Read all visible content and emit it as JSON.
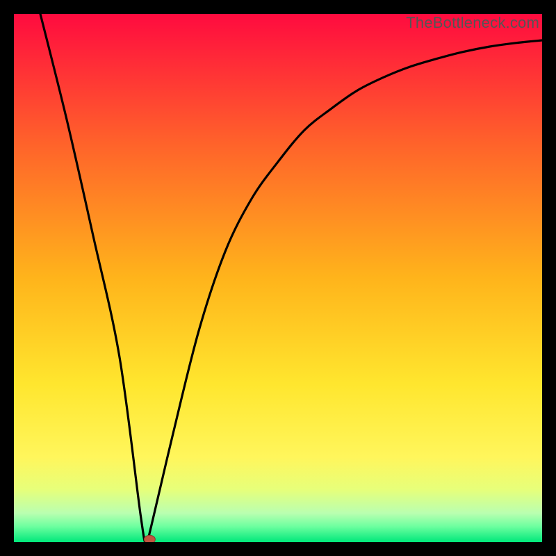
{
  "watermark": "TheBottleneck.com",
  "chart_data": {
    "type": "line",
    "title": "",
    "xlabel": "",
    "ylabel": "",
    "xlim": [
      0,
      100
    ],
    "ylim": [
      0,
      100
    ],
    "series": [
      {
        "name": "curve",
        "x": [
          5,
          10,
          15,
          20,
          24,
          25,
          26,
          30,
          35,
          40,
          45,
          50,
          55,
          60,
          65,
          70,
          75,
          80,
          85,
          90,
          95,
          100
        ],
        "y": [
          100,
          80,
          58,
          35,
          5,
          0,
          3,
          20,
          40,
          55,
          65,
          72,
          78,
          82,
          85.5,
          88,
          90,
          91.5,
          92.8,
          93.8,
          94.5,
          95
        ]
      }
    ],
    "marker": {
      "x": 25.7,
      "y": 0.5
    },
    "gradient_stops": [
      {
        "offset": 0.0,
        "color": "#ff0b3f"
      },
      {
        "offset": 0.25,
        "color": "#ff642a"
      },
      {
        "offset": 0.5,
        "color": "#ffb41b"
      },
      {
        "offset": 0.7,
        "color": "#ffe62e"
      },
      {
        "offset": 0.84,
        "color": "#fff65c"
      },
      {
        "offset": 0.9,
        "color": "#e7ff7a"
      },
      {
        "offset": 0.945,
        "color": "#baffb0"
      },
      {
        "offset": 0.97,
        "color": "#6effa0"
      },
      {
        "offset": 1.0,
        "color": "#00e87b"
      }
    ]
  }
}
